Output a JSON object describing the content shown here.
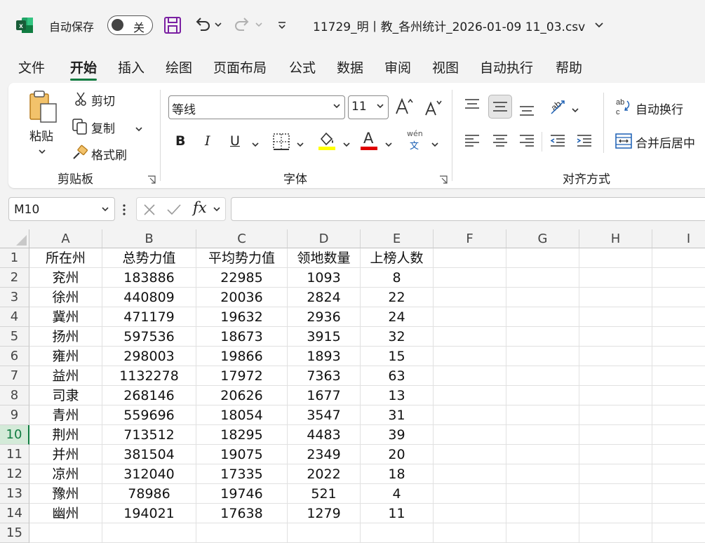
{
  "app": {
    "autosave_label": "自动保存",
    "autosave_state": "关",
    "document_title": "11729_明丨教_各州统计_2026-01-09 11_03.csv",
    "icons": [
      "excel-logo-icon",
      "save-icon",
      "undo-icon",
      "redo-icon",
      "customize-toolbar-icon"
    ],
    "brand_color": "#107c41"
  },
  "menu": {
    "tabs": [
      {
        "label": "文件"
      },
      {
        "label": "开始",
        "active": true
      },
      {
        "label": "插入"
      },
      {
        "label": "绘图"
      },
      {
        "label": "页面布局"
      },
      {
        "label": "公式"
      },
      {
        "label": "数据"
      },
      {
        "label": "审阅"
      },
      {
        "label": "视图"
      },
      {
        "label": "自动执行"
      },
      {
        "label": "帮助"
      }
    ]
  },
  "ribbon": {
    "clipboard": {
      "paste": "粘贴",
      "cut": "剪切",
      "copy": "复制",
      "format_painter": "格式刷",
      "group_label": "剪贴板"
    },
    "font": {
      "font_name": "等线",
      "font_size": "11",
      "bold": "B",
      "italic": "I",
      "underline": "U",
      "font_color_glyph": "A",
      "phonetic_top": "wén",
      "phonetic_bottom": "文",
      "group_label": "字体",
      "highlight_color": "#ffff00",
      "font_color": "#e00000"
    },
    "alignment": {
      "wrap_text": "自动换行",
      "merge_center": "合并后居中",
      "group_label": "对齐方式"
    }
  },
  "formula_bar": {
    "name_box": "M10",
    "fx_label": "fx",
    "formula": ""
  },
  "sheet": {
    "columns": [
      "A",
      "B",
      "C",
      "D",
      "E",
      "F",
      "G",
      "H",
      "I"
    ],
    "selected_row": 10,
    "row_numbers": [
      "1",
      "2",
      "3",
      "4",
      "5",
      "6",
      "7",
      "8",
      "9",
      "10",
      "11",
      "12",
      "13",
      "14",
      "15"
    ],
    "header": [
      "所在州",
      "总势力值",
      "平均势力值",
      "领地数量",
      "上榜人数"
    ],
    "rows": [
      [
        "兖州",
        "183886",
        "22985",
        "1093",
        "8"
      ],
      [
        "徐州",
        "440809",
        "20036",
        "2824",
        "22"
      ],
      [
        "冀州",
        "471179",
        "19632",
        "2936",
        "24"
      ],
      [
        "扬州",
        "597536",
        "18673",
        "3915",
        "32"
      ],
      [
        "雍州",
        "298003",
        "19866",
        "1893",
        "15"
      ],
      [
        "益州",
        "1132278",
        "17972",
        "7363",
        "63"
      ],
      [
        "司隶",
        "268146",
        "20626",
        "1677",
        "13"
      ],
      [
        "青州",
        "559696",
        "18054",
        "3547",
        "31"
      ],
      [
        "荆州",
        "713512",
        "18295",
        "4483",
        "39"
      ],
      [
        "并州",
        "381504",
        "19075",
        "2349",
        "20"
      ],
      [
        "凉州",
        "312040",
        "17335",
        "2022",
        "18"
      ],
      [
        "豫州",
        "78986",
        "19746",
        "521",
        "4"
      ],
      [
        "幽州",
        "194021",
        "17638",
        "1279",
        "11"
      ]
    ]
  }
}
